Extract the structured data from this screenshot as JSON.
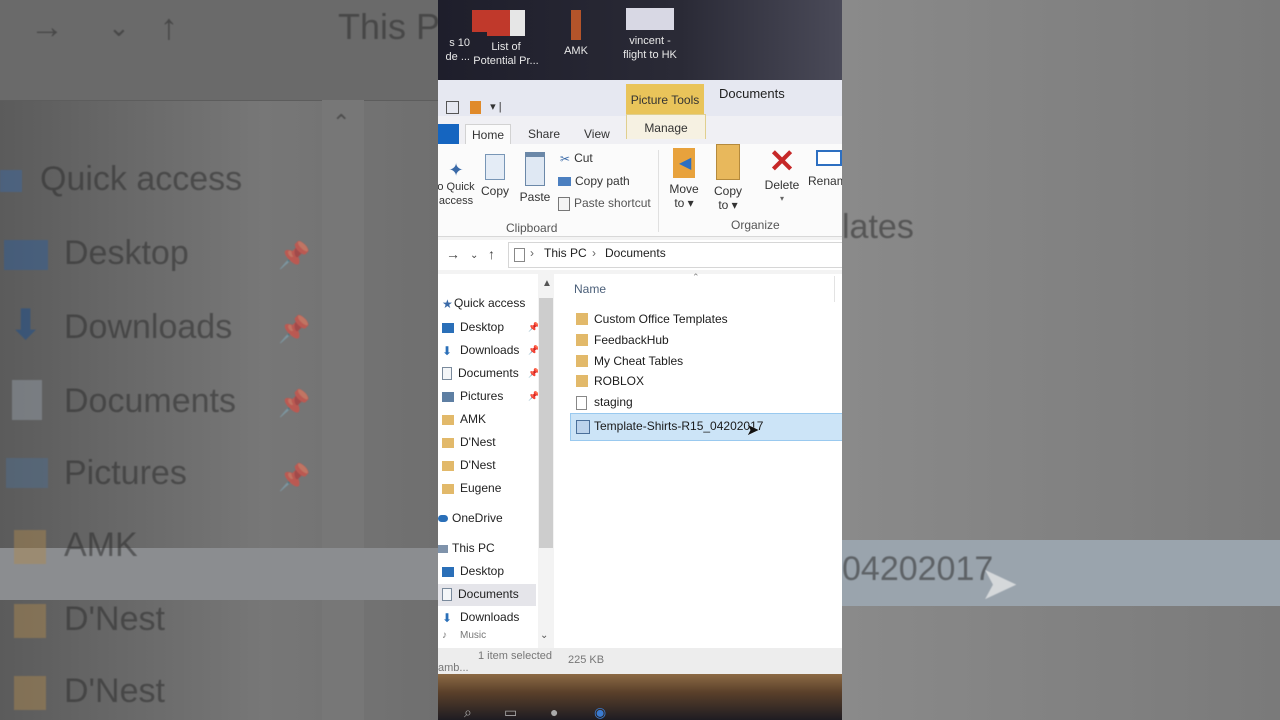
{
  "background": {
    "left_texts": [
      "Quick access",
      "Desktop",
      "Downloads",
      "Documents",
      "Pictures",
      "AMK",
      "D'Nest",
      "D'Nest",
      "This P"
    ],
    "right_texts": [
      "lates",
      "04202017"
    ]
  },
  "desktop": {
    "icons": [
      {
        "label": "s 10\nde ..."
      },
      {
        "label": "List of\nPotential Pr..."
      },
      {
        "label": "AMK"
      },
      {
        "label": "vincent -\nflight to HK"
      }
    ]
  },
  "window": {
    "title": "Documents",
    "contextual_label": "Picture Tools",
    "qat_sep": "▾ |"
  },
  "tabs": {
    "home": "Home",
    "share": "Share",
    "view": "View",
    "manage": "Manage"
  },
  "ribbon": {
    "pin_label": "o Quick\naccess",
    "copy": "Copy",
    "paste": "Paste",
    "cut": "Cut",
    "copy_path": "Copy path",
    "paste_shortcut": "Paste shortcut",
    "clipboard_group": "Clipboard",
    "move_to": "Move\nto ▾",
    "copy_to": "Copy\nto ▾",
    "delete": "Delete",
    "rename": "Renam",
    "organize_group": "Organize"
  },
  "address": {
    "crumbs": [
      "This PC",
      "Documents"
    ]
  },
  "nav_pane": {
    "quick_access": "Quick access",
    "items": [
      "Desktop",
      "Downloads",
      "Documents",
      "Pictures",
      "AMK",
      "D'Nest",
      "D'Nest",
      "Eugene"
    ],
    "onedrive": "OneDrive",
    "this_pc": "This PC",
    "pc_items": [
      "Desktop",
      "Documents",
      "Downloads",
      "Music"
    ]
  },
  "files": {
    "column_name": "Name",
    "rows": [
      {
        "name": "Custom Office Templates",
        "type": "folder"
      },
      {
        "name": "FeedbackHub",
        "type": "folder"
      },
      {
        "name": "My Cheat Tables",
        "type": "folder"
      },
      {
        "name": "ROBLOX",
        "type": "folder"
      },
      {
        "name": "staging",
        "type": "file"
      },
      {
        "name": "Template-Shirts-R15_04202017",
        "type": "image"
      }
    ]
  },
  "status": {
    "left": "amb...",
    "selected": "1 item selected",
    "size": "225 KB"
  },
  "colors": {
    "accent": "#1565c0",
    "contextual": "#e9c45a",
    "selection": "#cce4f7",
    "folder": "#e2b96a"
  }
}
